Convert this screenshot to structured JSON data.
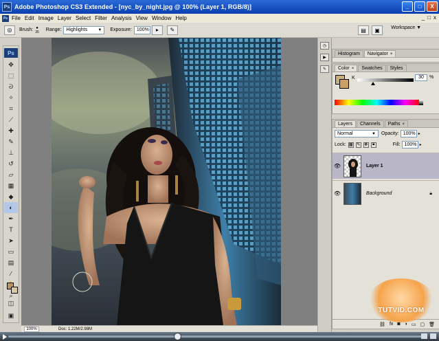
{
  "window": {
    "icon_text": "Ps",
    "title": "Adobe Photoshop CS3 Extended - [nyc_by_night.jpg @ 100% (Layer 1, RGB/8)]",
    "minimize": "_",
    "restore": "□",
    "close": "X"
  },
  "menu": {
    "items": [
      "File",
      "Edit",
      "Image",
      "Layer",
      "Select",
      "Filter",
      "Analysis",
      "View",
      "Window",
      "Help"
    ],
    "doc_controls": [
      "_",
      "□",
      "x"
    ]
  },
  "options": {
    "brush_label": "Brush:",
    "brush_size": "35",
    "range_label": "Range:",
    "range_value": "Highlights",
    "exposure_label": "Exposure:",
    "exposure_value": "100%",
    "workspace_label": "Workspace ▼"
  },
  "toolbox": {
    "logo": "Ps",
    "fg_color": "#b99661",
    "bg_color": "#d9c8a6"
  },
  "status": {
    "zoom": "100%",
    "doc_info": "Doc: 1.22M/2.98M"
  },
  "panels": {
    "top_tabs": [
      "Histogram",
      "Navigator"
    ],
    "color_tabs": [
      "Color",
      "Swatches",
      "Styles"
    ],
    "color_channel": "K",
    "color_value": "30",
    "color_pct": "%",
    "fg_swatch": "#c7b07c",
    "bg_swatch": "#caa064",
    "layer_tabs": [
      "Layers",
      "Channels",
      "Paths"
    ],
    "blend_mode": "Normal",
    "opacity_label": "Opacity:",
    "opacity_value": "100%",
    "lock_label": "Lock:",
    "fill_label": "Fill:",
    "fill_value": "100%",
    "layers": [
      {
        "name": "Layer 1",
        "selected": true
      },
      {
        "name": "Background",
        "selected": false
      }
    ],
    "footer_icons": [
      "link-icon",
      "fx-icon",
      "mask-icon",
      "adjustment-icon",
      "folder-icon",
      "new-layer-icon",
      "trash-icon"
    ]
  },
  "watermark": "TUTVID.COM",
  "colors": {
    "title_blue": "#0a3fb0",
    "panel_bg": "#d4d0c8",
    "canvas_gray": "#808080",
    "selected_layer": "#b9b6c8"
  }
}
